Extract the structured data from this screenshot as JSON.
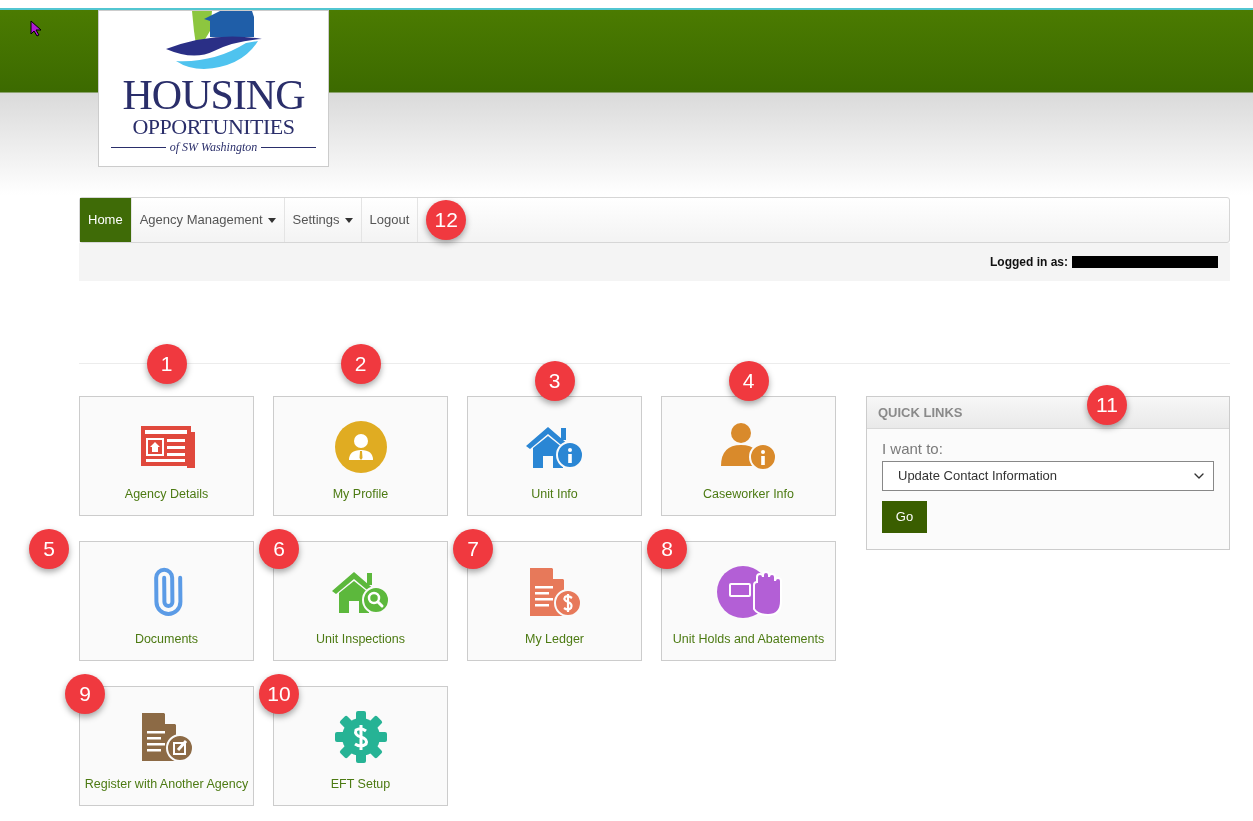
{
  "header": {
    "logo": {
      "title": "HOUSING",
      "subtitle": "OPPORTUNITIES",
      "tagline": "of SW Washington"
    }
  },
  "nav": {
    "items": [
      {
        "label": "Home",
        "selected": true,
        "dropdown": false
      },
      {
        "label": "Agency Management",
        "selected": false,
        "dropdown": true
      },
      {
        "label": "Settings",
        "selected": false,
        "dropdown": true
      },
      {
        "label": "Logout",
        "selected": false,
        "dropdown": false
      }
    ],
    "callout": "12"
  },
  "user_bar": {
    "label": "Logged in as:"
  },
  "tiles": [
    {
      "label": "Agency Details",
      "color": "#e0483c",
      "callout": "1"
    },
    {
      "label": "My Profile",
      "color": "#e0ac22",
      "callout": "2"
    },
    {
      "label": "Unit Info",
      "color": "#2a86d4",
      "callout": "3"
    },
    {
      "label": "Caseworker Info",
      "color": "#d98a2b",
      "callout": "4"
    },
    {
      "label": "Documents",
      "color": "#5b9be6",
      "callout": "5"
    },
    {
      "label": "Unit Inspections",
      "color": "#5cb83c",
      "callout": "6"
    },
    {
      "label": "My Ledger",
      "color": "#e7795a",
      "callout": "7"
    },
    {
      "label": "Unit Holds and Abatements",
      "color": "#b35fd6",
      "callout": "8"
    },
    {
      "label": "Register with Another Agency",
      "color": "#8c6a45",
      "callout": "9"
    },
    {
      "label": "EFT Setup",
      "color": "#26b395",
      "callout": "10"
    }
  ],
  "quick_links": {
    "title": "QUICK LINKS",
    "callout": "11",
    "prompt": "I want to:",
    "select": {
      "value": "Update Contact Information"
    },
    "button": "Go"
  }
}
